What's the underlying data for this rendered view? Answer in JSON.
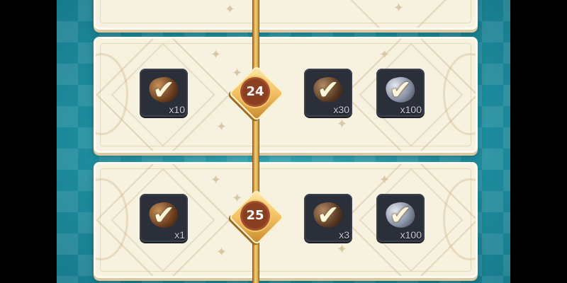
{
  "rows": [
    {
      "level": "24",
      "rewards": [
        {
          "icon": "copper-ore-icon",
          "quantity": "x10",
          "claimed": true
        },
        {
          "icon": "iron-ore-icon",
          "quantity": "x30",
          "claimed": true
        },
        {
          "icon": "silver-ore-icon",
          "quantity": "x100",
          "claimed": true
        }
      ]
    },
    {
      "level": "25",
      "rewards": [
        {
          "icon": "copper-ore-icon",
          "quantity": "x1",
          "claimed": true
        },
        {
          "icon": "iron-ore-icon",
          "quantity": "x3",
          "claimed": true
        },
        {
          "icon": "silver-ore-icon",
          "quantity": "x100",
          "claimed": true
        }
      ]
    }
  ],
  "check_glyph": "✔",
  "colors": {
    "background": "#1f8fa0",
    "panel": "#f7f1e0",
    "track": "#f2c062",
    "level_seal": "#8a3e22",
    "tile": "#2b2f3a"
  }
}
